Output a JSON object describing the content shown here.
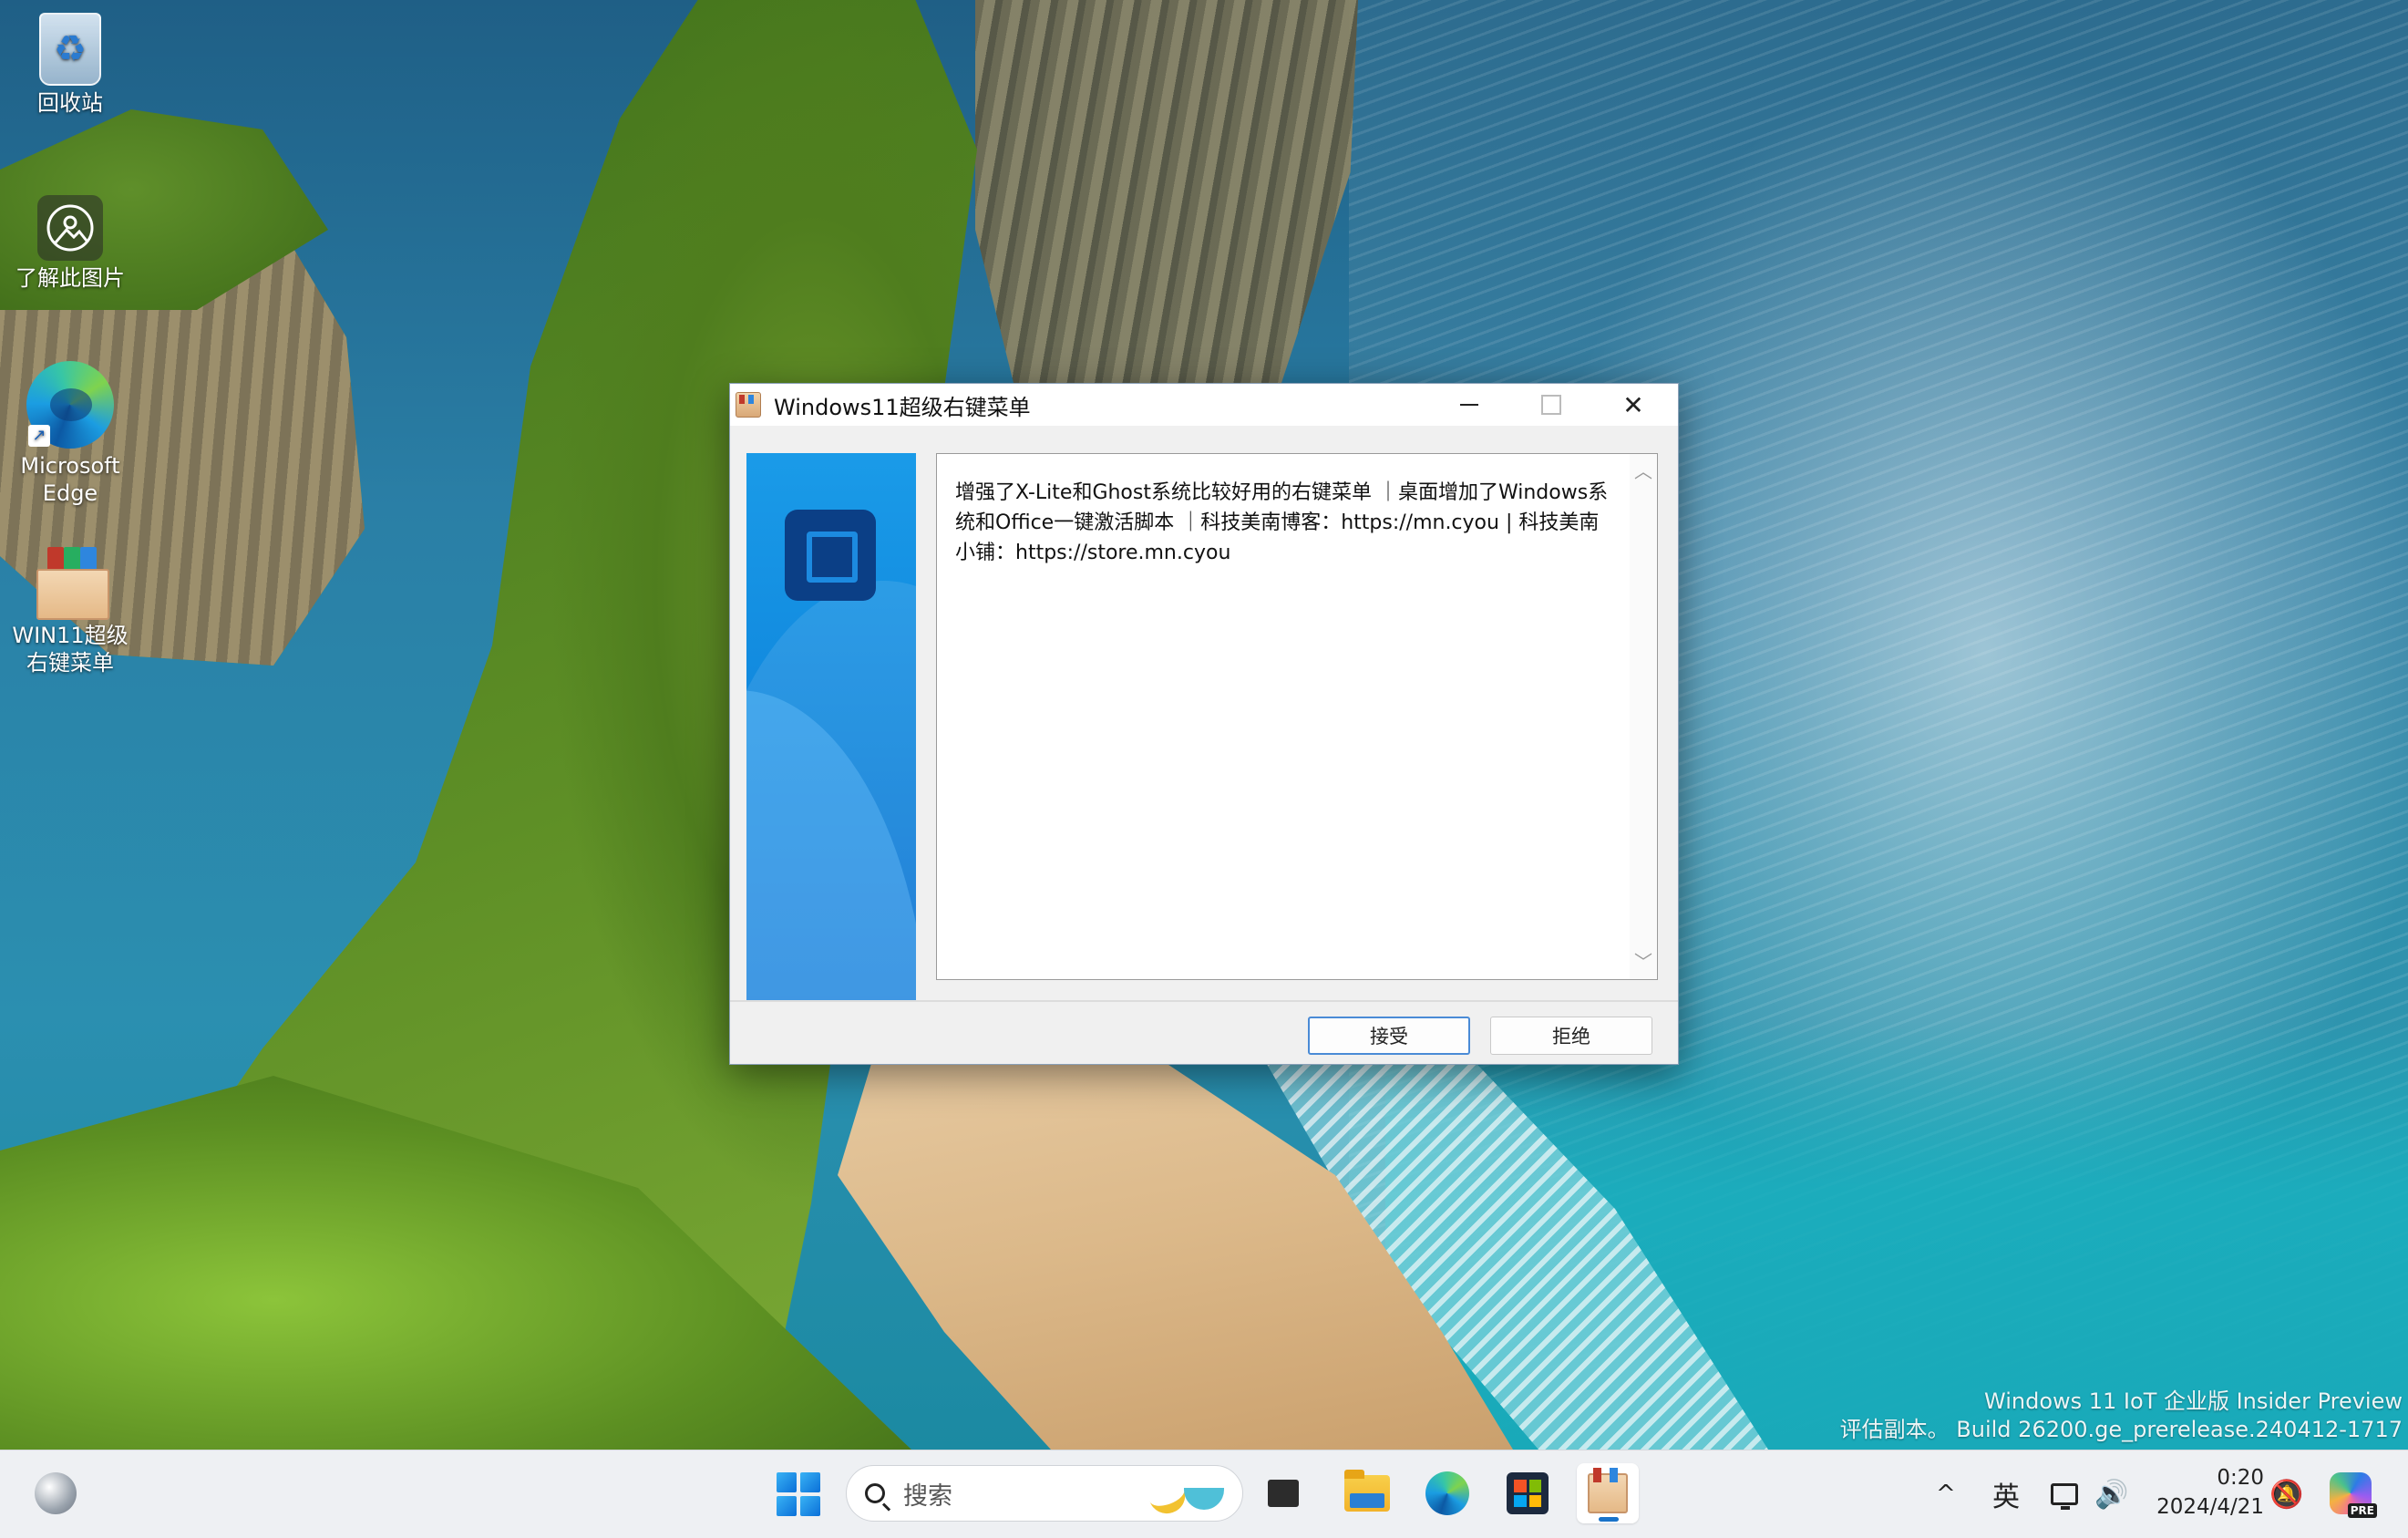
{
  "desktop": {
    "icons": [
      {
        "label": "回收站",
        "icon": "recycle-bin-icon"
      },
      {
        "label": "了解此图片",
        "icon": "learn-about-picture-icon"
      },
      {
        "label": "Microsoft Edge",
        "icon": "edge-icon"
      },
      {
        "label": "WIN11超级右键菜单",
        "icon": "winrar-archive-icon"
      }
    ],
    "watermark": {
      "line1": "Windows 11 IoT 企业版 Insider Preview",
      "line2": "评估副本。 Build 26200.ge_prerelease.240412-1717"
    }
  },
  "dialog": {
    "title": "Windows11超级右键菜单",
    "content": "增强了X-Lite和Ghost系统比较好用的右键菜单 ｜桌面增加了Windows系统和Office一键激活脚本 ｜科技美南博客：https://mn.cyou | 科技美南小铺：https://store.mn.cyou",
    "accept_label": "接受",
    "reject_label": "拒绝",
    "scroll_up": "︿",
    "scroll_down": "﹀",
    "close_glyph": "✕"
  },
  "taskbar": {
    "search_placeholder": "搜索",
    "apps": [
      "task-view",
      "file-explorer",
      "edge",
      "microsoft-store",
      "winrar"
    ],
    "tray": {
      "chevron": "^",
      "ime": "英",
      "volume_glyph": "🔊",
      "bell_glyph": "🔕",
      "time": "0:20",
      "date": "2024/4/21",
      "copilot_badge": "PRE"
    }
  },
  "colors": {
    "accent": "#1a73c9",
    "dialog_panel": "#0f85dc"
  }
}
